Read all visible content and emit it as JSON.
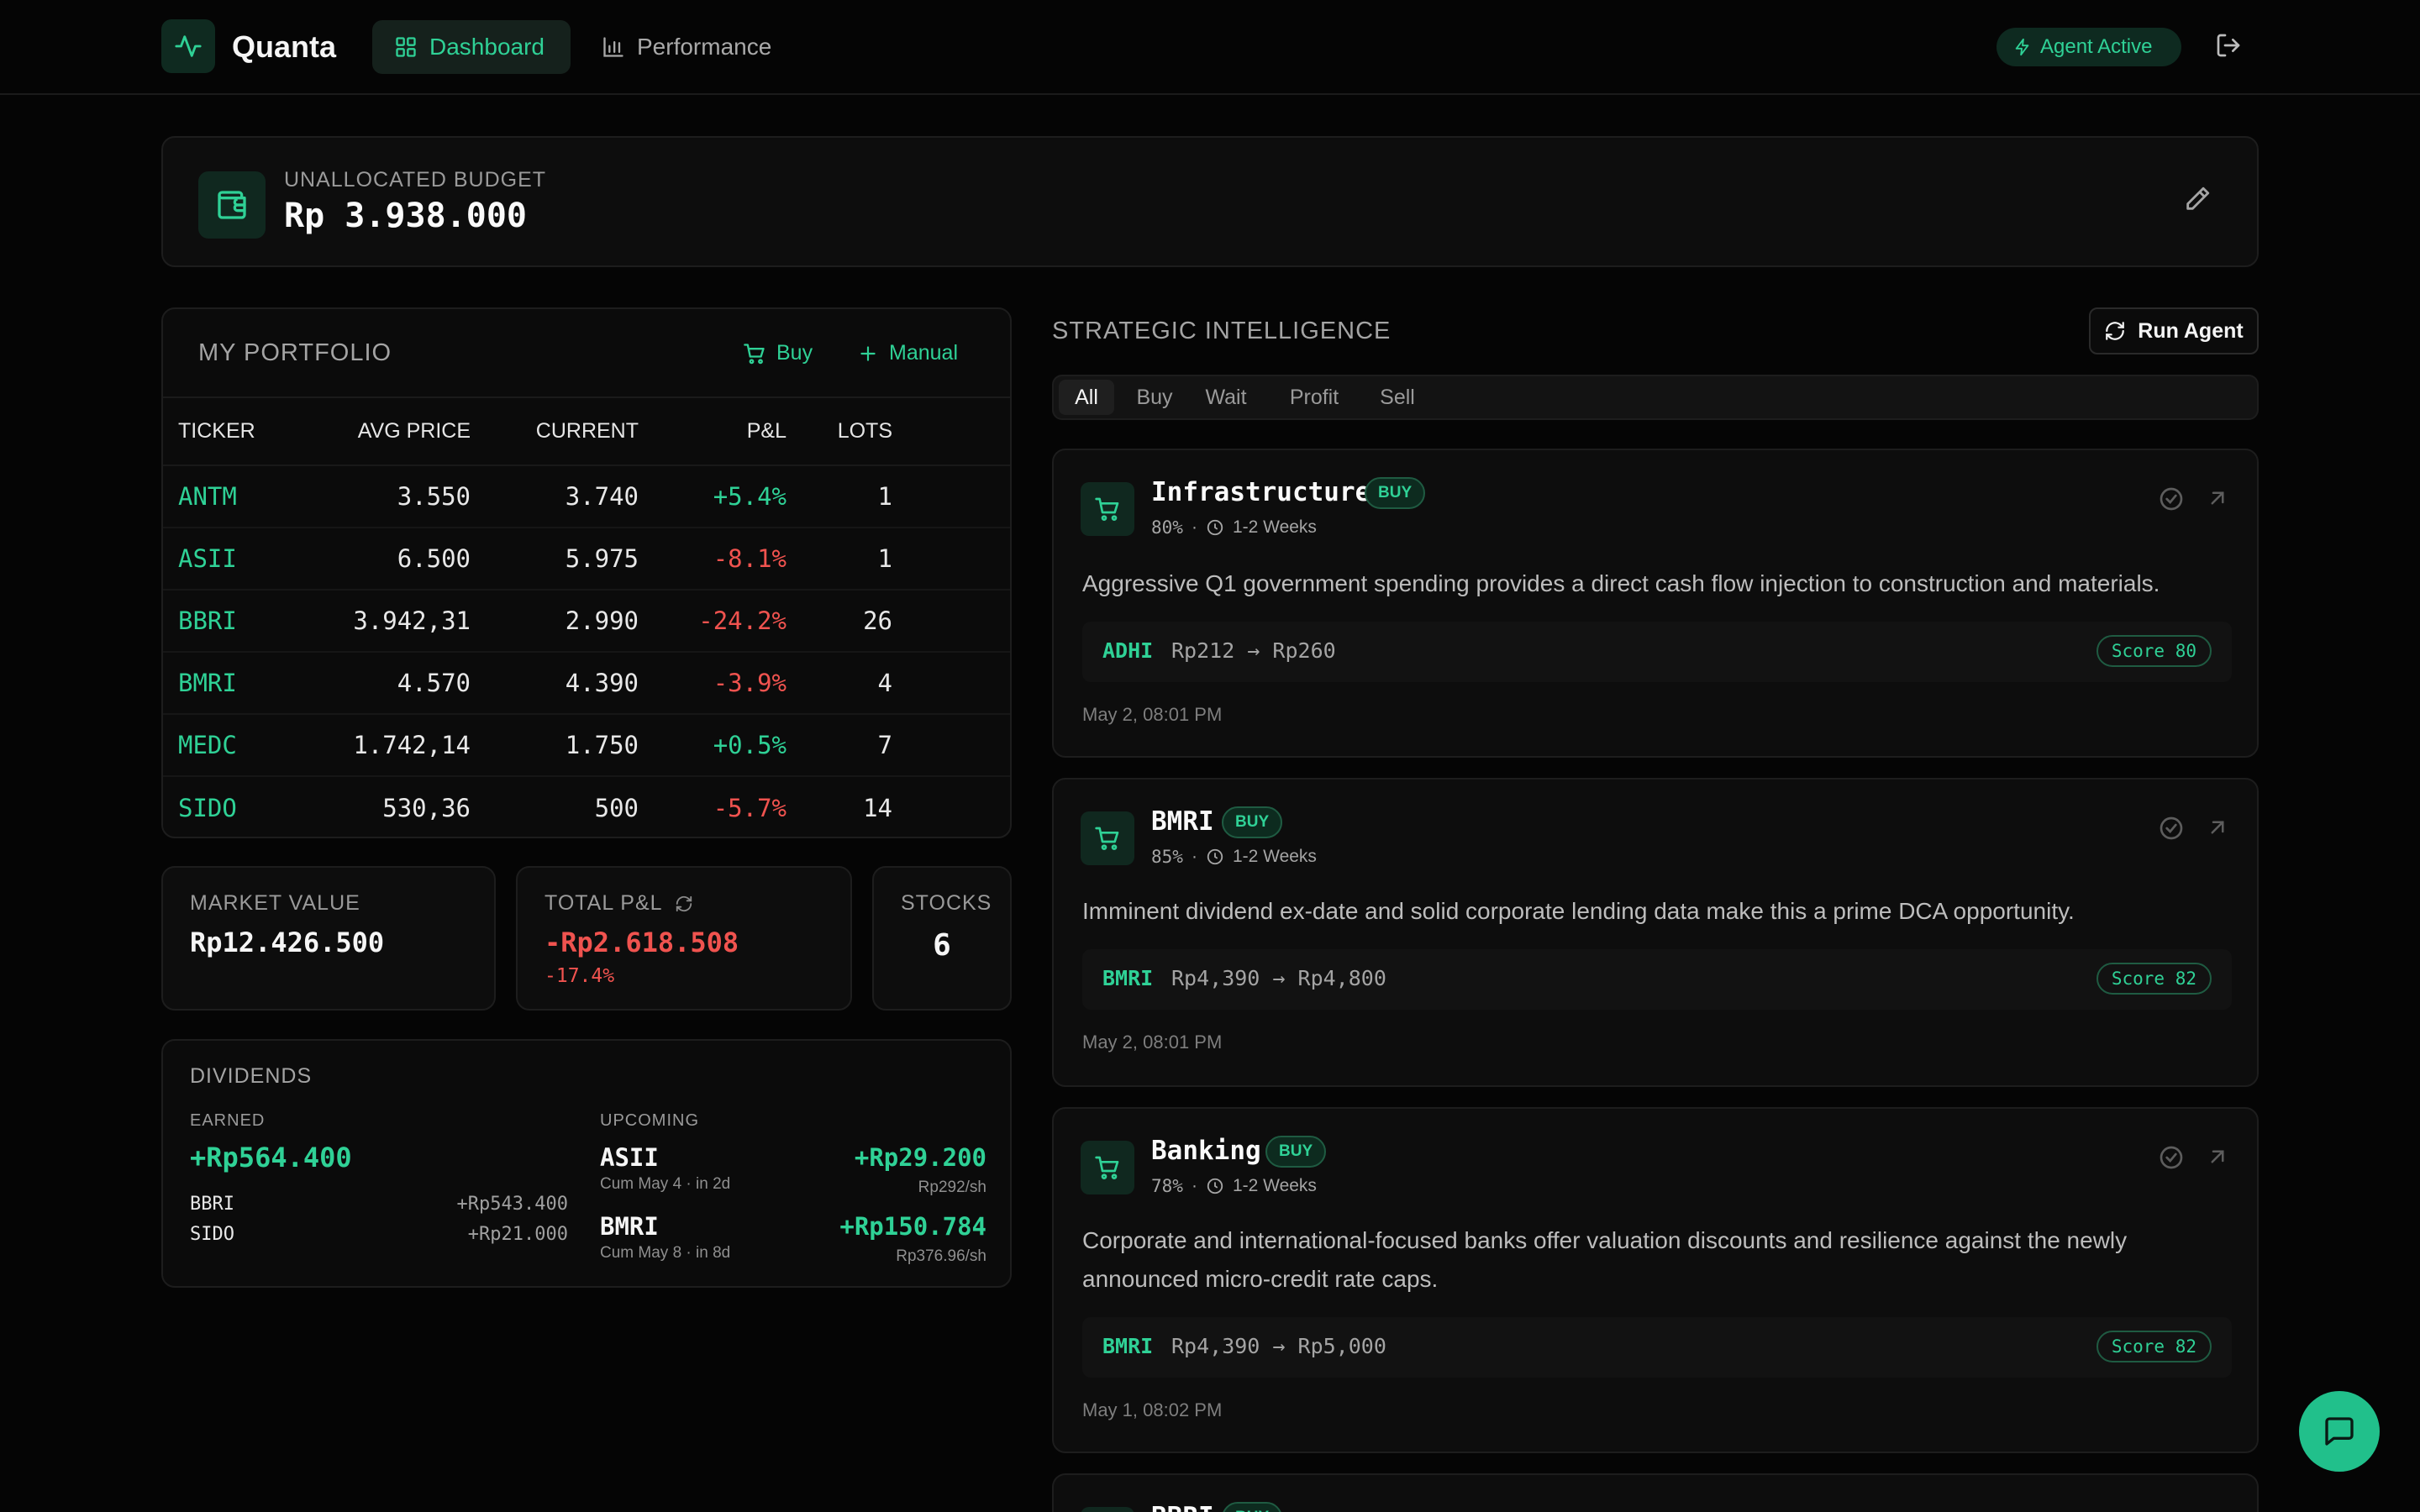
{
  "app": {
    "title": "Quanta",
    "accent_color": "#2fd196",
    "negative_color": "#f0534f",
    "nav": [
      {
        "label": "Dashboard",
        "icon": "grid-icon",
        "active": true
      },
      {
        "label": "Performance",
        "icon": "bar-chart-icon",
        "active": false
      }
    ],
    "agent_status": "Agent Active"
  },
  "budget": {
    "label": "UNALLOCATED BUDGET",
    "value": "Rp 3.938.000"
  },
  "portfolio": {
    "title": "MY PORTFOLIO",
    "buy_label": "Buy",
    "manual_label": "Manual",
    "columns": [
      "TICKER",
      "AVG PRICE",
      "CURRENT",
      "P&L",
      "LOTS"
    ],
    "rows": [
      {
        "ticker": "ANTM",
        "avg": "3.550",
        "current": "3.740",
        "pl": "+5.4%",
        "lots": "1"
      },
      {
        "ticker": "ASII",
        "avg": "6.500",
        "current": "5.975",
        "pl": "-8.1%",
        "lots": "1"
      },
      {
        "ticker": "BBRI",
        "avg": "3.942,31",
        "current": "2.990",
        "pl": "-24.2%",
        "lots": "26"
      },
      {
        "ticker": "BMRI",
        "avg": "4.570",
        "current": "4.390",
        "pl": "-3.9%",
        "lots": "4"
      },
      {
        "ticker": "MEDC",
        "avg": "1.742,14",
        "current": "1.750",
        "pl": "+0.5%",
        "lots": "7"
      },
      {
        "ticker": "SIDO",
        "avg": "530,36",
        "current": "500",
        "pl": "-5.7%",
        "lots": "14"
      }
    ]
  },
  "stats": {
    "market_value": {
      "label": "MARKET VALUE",
      "value": "Rp12.426.500"
    },
    "total_pl": {
      "label": "TOTAL P&L",
      "value": "-Rp2.618.508",
      "percent": "-17.4%"
    },
    "stocks": {
      "label": "STOCKS",
      "value": "6"
    }
  },
  "dividends": {
    "title": "DIVIDENDS",
    "earned_label": "EARNED",
    "earned_total": "+Rp564.400",
    "earned_items": [
      {
        "ticker": "BBRI",
        "amount": "+Rp543.400"
      },
      {
        "ticker": "SIDO",
        "amount": "+Rp21.000"
      }
    ],
    "upcoming_label": "UPCOMING",
    "upcoming_items": [
      {
        "ticker": "ASII",
        "detail": "Cum May 4 · in 2d",
        "amount": "+Rp29.200",
        "per_share": "Rp292/sh"
      },
      {
        "ticker": "BMRI",
        "detail": "Cum May 8 · in 8d",
        "amount": "+Rp150.784",
        "per_share": "Rp376.96/sh"
      }
    ]
  },
  "intelligence": {
    "title": "STRATEGIC INTELLIGENCE",
    "run_label": "Run Agent",
    "filters": [
      "All",
      "Buy",
      "Wait",
      "Profit",
      "Sell"
    ],
    "active_filter": "All",
    "recommendations": [
      {
        "name": "Infrastructure",
        "badge": "BUY",
        "confidence": "80%",
        "horizon": "1-2 Weeks",
        "description": "Aggressive Q1 government spending provides a direct cash flow injection to construction and materials.",
        "ticker": "ADHI",
        "range": "Rp212 → Rp260",
        "score": "Score 80",
        "date": "May 2, 08:01 PM"
      },
      {
        "name": "BMRI",
        "badge": "BUY",
        "confidence": "85%",
        "horizon": "1-2 Weeks",
        "description": "Imminent dividend ex-date and solid corporate lending data make this a prime DCA opportunity.",
        "ticker": "BMRI",
        "range": "Rp4,390 → Rp4,800",
        "score": "Score 82",
        "date": "May 2, 08:01 PM"
      },
      {
        "name": "Banking",
        "badge": "BUY",
        "confidence": "78%",
        "horizon": "1-2 Weeks",
        "description": "Corporate and international-focused banks offer valuation discounts and resilience against the newly announced micro-credit rate caps.",
        "ticker": "BMRI",
        "range": "Rp4,390 → Rp5,000",
        "score": "Score 82",
        "date": "May 1, 08:02 PM"
      },
      {
        "name": "BBRI",
        "badge": "BUY"
      }
    ]
  }
}
